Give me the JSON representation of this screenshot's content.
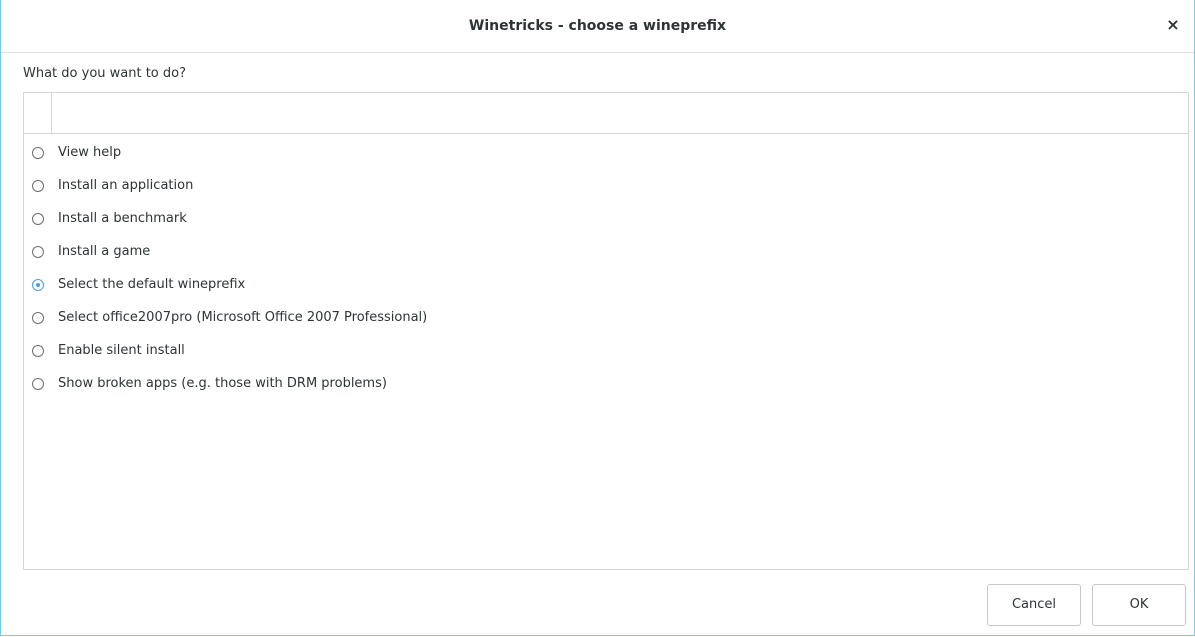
{
  "window": {
    "title": "Winetricks - choose a wineprefix",
    "close_glyph": "×"
  },
  "prompt": "What do you want to do?",
  "options": [
    {
      "label": "View help",
      "selected": false
    },
    {
      "label": "Install an application",
      "selected": false
    },
    {
      "label": "Install a benchmark",
      "selected": false
    },
    {
      "label": "Install a game",
      "selected": false
    },
    {
      "label": "Select the default wineprefix",
      "selected": true
    },
    {
      "label": "Select office2007pro (Microsoft Office 2007 Professional)",
      "selected": false
    },
    {
      "label": "Enable silent install",
      "selected": false
    },
    {
      "label": "Show broken apps (e.g. those with DRM problems)",
      "selected": false
    }
  ],
  "buttons": {
    "cancel": "Cancel",
    "ok": "OK"
  },
  "colors": {
    "accent": "#4a9fd8",
    "window_border": "#7fc8e8"
  },
  "icons": {
    "close": "close-icon",
    "radio": "radio-button-icon"
  }
}
